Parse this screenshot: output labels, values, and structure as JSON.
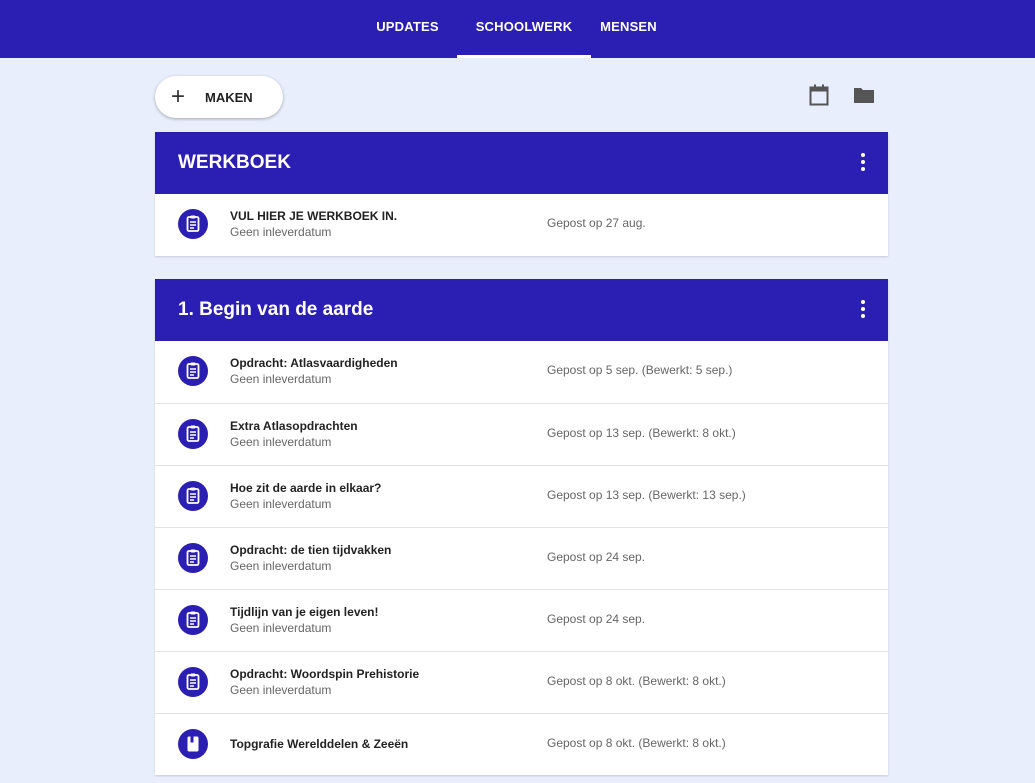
{
  "nav": {
    "tabs": [
      {
        "label": "UPDATES",
        "active": false
      },
      {
        "label": "SCHOOLWERK",
        "active": true
      },
      {
        "label": "MENSEN",
        "active": false
      }
    ],
    "background_color": "#2b1eb2"
  },
  "toolbar": {
    "make_label": "MAKEN",
    "make_icon": "plus-icon",
    "right_icons": [
      "calendar-icon",
      "folder-icon"
    ]
  },
  "sections": [
    {
      "title": "WERKBOEK",
      "items": [
        {
          "title": "VUL HIER JE WERKBOEK IN.",
          "subtitle": "Geen inleverdatum",
          "posted": "Gepost op 27 aug.",
          "icon": "assignment-icon"
        }
      ]
    },
    {
      "title": "1. Begin van de aarde",
      "items": [
        {
          "title": "Opdracht: Atlasvaardigheden",
          "subtitle": "Geen inleverdatum",
          "posted": "Gepost op 5 sep. (Bewerkt: 5 sep.)",
          "icon": "assignment-icon"
        },
        {
          "title": "Extra Atlasopdrachten",
          "subtitle": "Geen inleverdatum",
          "posted": "Gepost op 13 sep. (Bewerkt: 8 okt.)",
          "icon": "assignment-icon"
        },
        {
          "title": "Hoe zit de aarde in elkaar?",
          "subtitle": "Geen inleverdatum",
          "posted": "Gepost op 13 sep. (Bewerkt: 13 sep.)",
          "icon": "assignment-icon"
        },
        {
          "title": "Opdracht: de tien tijdvakken",
          "subtitle": "Geen inleverdatum",
          "posted": "Gepost op 24 sep.",
          "icon": "assignment-icon"
        },
        {
          "title": "Tijdlijn van je eigen leven!",
          "subtitle": "Geen inleverdatum",
          "posted": "Gepost op 24 sep.",
          "icon": "assignment-icon"
        },
        {
          "title": "Opdracht: Woordspin Prehistorie",
          "subtitle": "Geen inleverdatum",
          "posted": "Gepost op 8 okt. (Bewerkt: 8 okt.)",
          "icon": "assignment-icon"
        },
        {
          "title": "Topgrafie Werelddelen & Zeeën",
          "subtitle": "",
          "posted": "Gepost op 8 okt. (Bewerkt: 8 okt.)",
          "icon": "material-icon"
        }
      ]
    }
  ]
}
